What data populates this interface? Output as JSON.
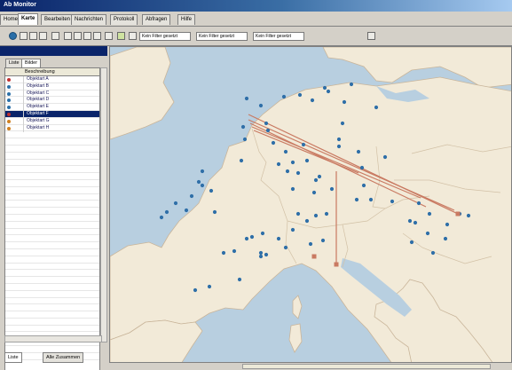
{
  "window": {
    "title": "Ab Monitor"
  },
  "menu": {
    "tabs": [
      "Home",
      "Karte",
      "Bearbeiten",
      "Nachrichten",
      "Protokoll",
      "Abfragen",
      "Hilfe"
    ],
    "active": 1
  },
  "toolbar": {
    "filters": [
      "Kein Filter gesetzt",
      "Kein Filter gesetzt",
      "Kein Filter gesetzt"
    ]
  },
  "sidebar": {
    "tabs": [
      "Liste",
      "Bilder"
    ],
    "column_header": "Beschreibung",
    "items": [
      {
        "label": "Objektart A",
        "color": "#c03030"
      },
      {
        "label": "Objektart B",
        "color": "#2a6fa8"
      },
      {
        "label": "Objektart C",
        "color": "#2a6fa8"
      },
      {
        "label": "Objektart D",
        "color": "#2a6fa8"
      },
      {
        "label": "Objektart E",
        "color": "#2a6fa8"
      },
      {
        "label": "Objektart F",
        "color": "#c03030",
        "selected": true
      },
      {
        "label": "Objektart G",
        "color": "#d08020"
      },
      {
        "label": "Objektart H",
        "color": "#d08020"
      }
    ],
    "bottom_tabs": [
      "Liste",
      "Alle Zusammen"
    ]
  },
  "map": {
    "colors": {
      "sea": "#b8cfe0",
      "land": "#f2ead8",
      "border": "#c9b59a",
      "marker": "#2f6fa8",
      "route": "#c97a62"
    }
  }
}
